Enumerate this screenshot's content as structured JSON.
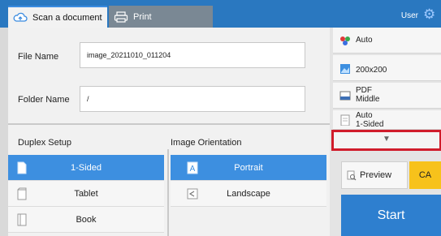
{
  "tabs": [
    {
      "label": "Scan a document",
      "icon": "scan-cloud-icon"
    },
    {
      "label": "Print",
      "icon": "printer-icon"
    }
  ],
  "header": {
    "user_label": "User",
    "settings_icon": "gear-icon"
  },
  "fields": {
    "file_name_label": "File Name",
    "file_name_value": "image_20211010_011204",
    "folder_name_label": "Folder Name",
    "folder_name_value": "/"
  },
  "duplex": {
    "title": "Duplex Setup",
    "options": [
      "1-Sided",
      "Tablet",
      "Book"
    ],
    "selected": "1-Sided"
  },
  "orientation": {
    "title": "Image Orientation",
    "options": [
      "Portrait",
      "Landscape"
    ],
    "selected": "Portrait"
  },
  "settings": {
    "color": "Auto",
    "resolution": "200x200",
    "format_line1": "PDF",
    "format_line2": "Middle",
    "size_line1": "Auto",
    "size_line2": "1-Sided"
  },
  "actions": {
    "preview": "Preview",
    "ca": "CA",
    "start": "Start"
  },
  "colors": {
    "accent": "#3d8fe0",
    "topbar": "#2a78c0",
    "highlight_border": "#d01c2b",
    "ca": "#f7c21b"
  }
}
